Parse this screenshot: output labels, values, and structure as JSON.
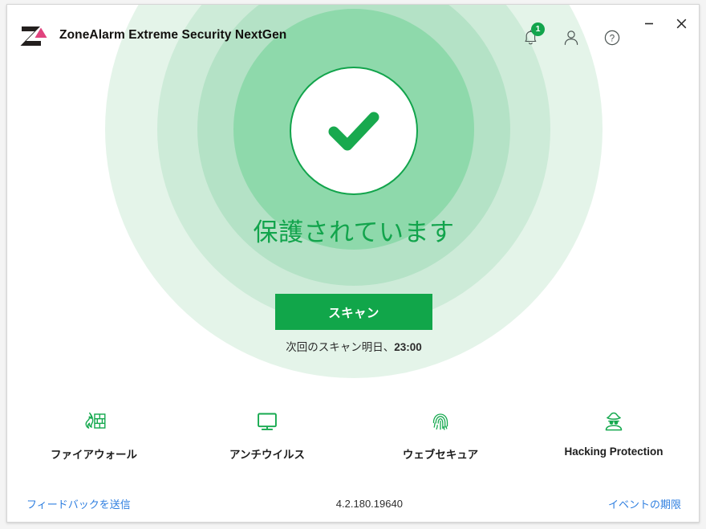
{
  "window": {
    "title": "ZoneAlarm Extreme Security NextGen",
    "logo_icon": "zonealarm-z-logo",
    "controls": {
      "minimize_label": "–",
      "minimize_icon": "minimize-icon",
      "close_label": "✕",
      "close_icon": "close-icon"
    }
  },
  "header": {
    "actions": [
      {
        "name": "notifications",
        "icon": "bell-icon",
        "badge": "1"
      },
      {
        "name": "account",
        "icon": "person-icon",
        "badge": ""
      },
      {
        "name": "help",
        "icon": "question-mark-icon",
        "badge": ""
      }
    ]
  },
  "status": {
    "icon": "checkmark-icon",
    "text": "保護されています",
    "scan_button_label": "スキャン",
    "next_scan_prefix": "次回のスキャン明日、",
    "next_scan_time": "23:00"
  },
  "features": [
    {
      "label": "ファイアウォール",
      "icon": "firewall-icon",
      "name": "firewall"
    },
    {
      "label": "アンチウイルス",
      "icon": "monitor-icon",
      "name": "antivirus"
    },
    {
      "label": "ウェブセキュア",
      "icon": "fingerprint-icon",
      "name": "web-secure"
    },
    {
      "label": "Hacking Protection",
      "icon": "spy-icon",
      "name": "hacking-protection"
    }
  ],
  "footer": {
    "feedback_label": "フィードバックを送信",
    "version": "4.2.180.19640",
    "events_label": "イベントの期限"
  },
  "colors": {
    "accent_green": "#11a64a",
    "status_green": "#12a44c",
    "link_blue": "#2f7fe0",
    "logo_dark": "#231f1e",
    "logo_pink": "#e0447e",
    "ring_1": "#e4f4e9",
    "ring_2": "#cdebd8",
    "ring_3": "#b4e2c6",
    "ring_4": "#8ed9ab"
  }
}
